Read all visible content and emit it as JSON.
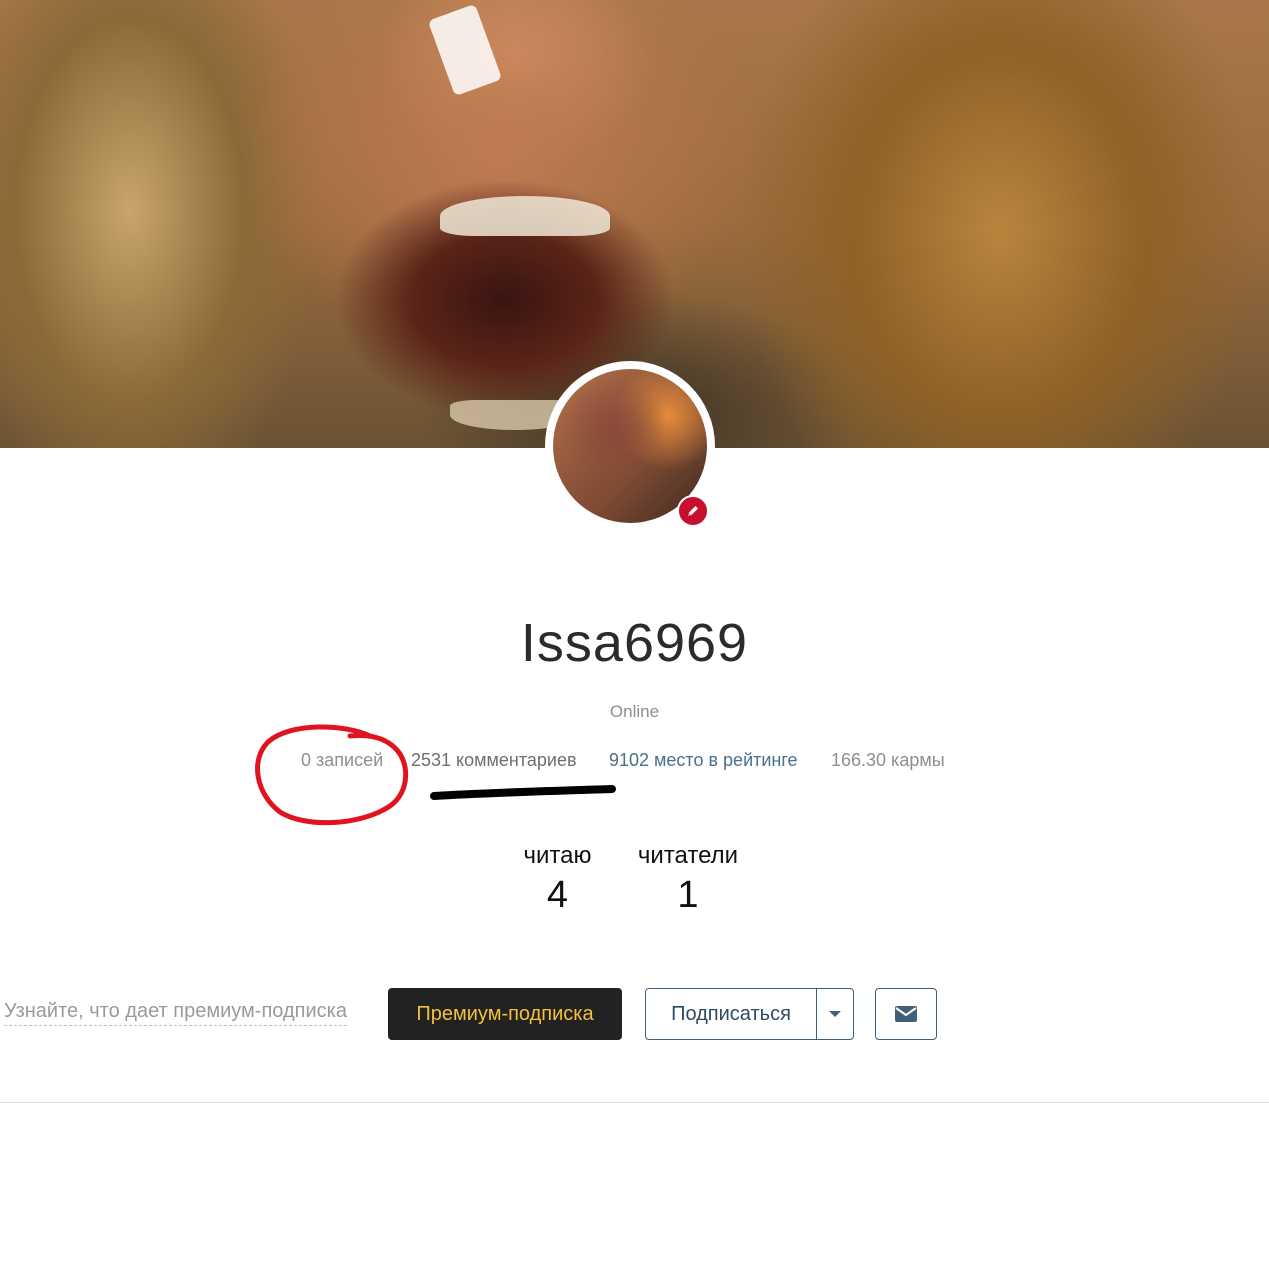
{
  "profile": {
    "username": "Issa6969",
    "status": "Online"
  },
  "stats": {
    "posts": "0 записей",
    "comments": "2531 комментариев",
    "rating": "9102 место в рейтинге",
    "karma": "166.30 кармы"
  },
  "follow": {
    "reading_label": "читаю",
    "reading_count": "4",
    "readers_label": "читатели",
    "readers_count": "1"
  },
  "actions": {
    "premium_info_link": "Узнайте, что дает премиум-подписка",
    "premium_button": "Премиум-подписка",
    "subscribe_button": "Подписаться",
    "dropdown_icon": "caret-down-icon",
    "message_icon": "envelope-icon"
  },
  "colors": {
    "premium_bg": "#222222",
    "premium_text": "#f2c13b",
    "rating_link": "#4a6f8a",
    "annotation_circle": "#e0141e",
    "annotation_underline": "#000000",
    "edit_badge": "#c8102e"
  }
}
